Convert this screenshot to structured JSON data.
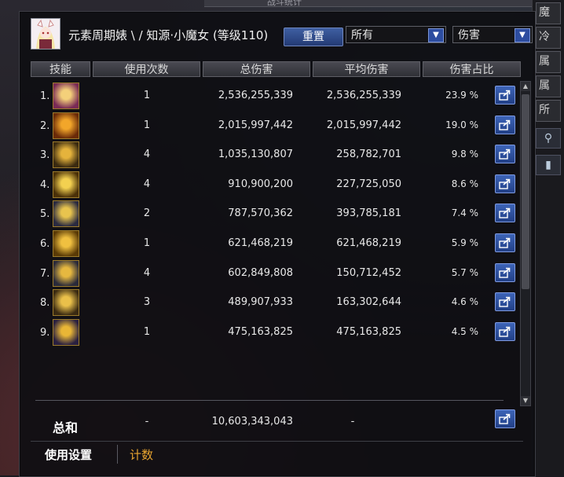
{
  "app": {
    "top_tab_label": "战斗统计"
  },
  "header": {
    "character_name": "元素周期婊 \\ / 知源·小魔女 (等级110)",
    "reset_button": "重置",
    "filter_select": "所有",
    "metric_select": "伤害"
  },
  "table": {
    "columns": [
      "技能",
      "使用次数",
      "总伤害",
      "平均伤害",
      "伤害占比"
    ],
    "rows": [
      {
        "index": "1.",
        "icon": "skill-icon-dark-gate",
        "uses": "1",
        "total": "2,536,255,339",
        "avg": "2,536,255,339",
        "pct": "23.9 %",
        "color_a": "#f4d07a",
        "color_b": "#7a2a55"
      },
      {
        "index": "2.",
        "icon": "skill-icon-fire-beam",
        "uses": "1",
        "total": "2,015,997,442",
        "avg": "2,015,997,442",
        "pct": "19.0 %",
        "color_a": "#f2a62a",
        "color_b": "#6a2a08"
      },
      {
        "index": "3.",
        "icon": "skill-icon-cat-fire",
        "uses": "4",
        "total": "1,035,130,807",
        "avg": "258,782,701",
        "pct": "9.8 %",
        "color_a": "#e5b33c",
        "color_b": "#3a2a10"
      },
      {
        "index": "4.",
        "icon": "skill-icon-burst",
        "uses": "4",
        "total": "910,900,200",
        "avg": "227,725,050",
        "pct": "8.6 %",
        "color_a": "#f3d050",
        "color_b": "#4a3008"
      },
      {
        "index": "5.",
        "icon": "skill-icon-scroll-blue",
        "uses": "2",
        "total": "787,570,362",
        "avg": "393,785,181",
        "pct": "7.4 %",
        "color_a": "#e8c44e",
        "color_b": "#2a2a40"
      },
      {
        "index": "6.",
        "icon": "skill-icon-flame",
        "uses": "1",
        "total": "621,468,219",
        "avg": "621,468,219",
        "pct": "5.9 %",
        "color_a": "#f0c040",
        "color_b": "#5a3a06"
      },
      {
        "index": "7.",
        "icon": "skill-icon-vortex",
        "uses": "4",
        "total": "602,849,808",
        "avg": "150,712,452",
        "pct": "5.7 %",
        "color_a": "#e6b840",
        "color_b": "#2a2a3a"
      },
      {
        "index": "8.",
        "icon": "skill-icon-rune",
        "uses": "3",
        "total": "489,907,933",
        "avg": "163,302,644",
        "pct": "4.6 %",
        "color_a": "#eac04a",
        "color_b": "#3a2a12"
      },
      {
        "index": "9.",
        "icon": "skill-icon-heart-sigil",
        "uses": "1",
        "total": "475,163,825",
        "avg": "475,163,825",
        "pct": "4.5 %",
        "color_a": "#e9b636",
        "color_b": "#2a2040"
      }
    ]
  },
  "totals": {
    "label": "总和",
    "uses": "-",
    "total": "10,603,343,043",
    "avg": "-"
  },
  "bottom_tabs": {
    "usage": "使用设置",
    "count": "计数"
  },
  "sidebar_right": {
    "tabs": [
      "魔",
      "冷",
      "属",
      "属",
      "所"
    ]
  }
}
